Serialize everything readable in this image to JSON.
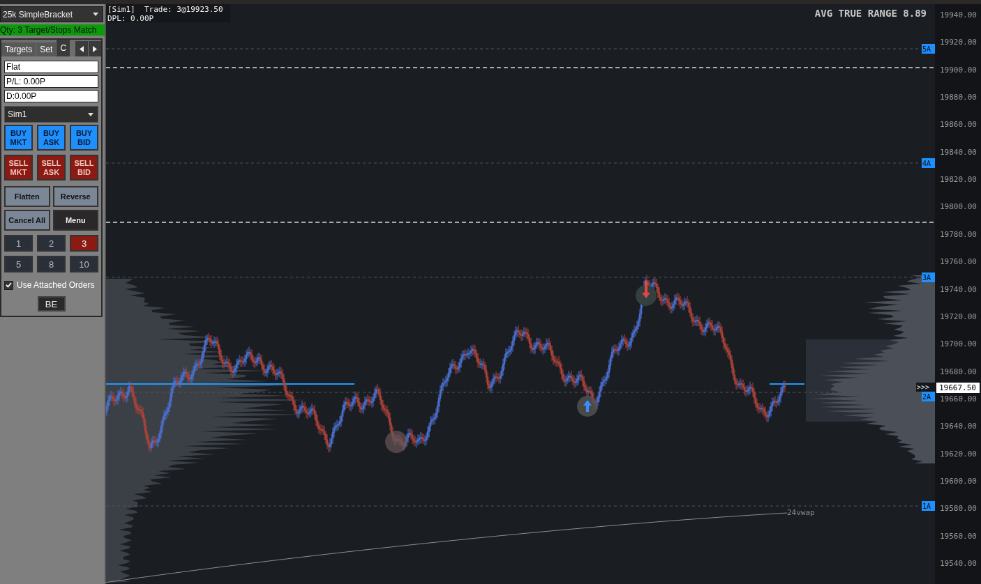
{
  "order_panel": {
    "strategy_dropdown": "25k SimpleBracket",
    "status_banner": "Qty: 3 Target/Stops Match",
    "tabs": [
      {
        "label": "Targets",
        "selected": false
      },
      {
        "label": "Set",
        "selected": false
      },
      {
        "label": "C",
        "selected": true
      }
    ],
    "fields": [
      "Flat",
      "P/L: 0.00P",
      "D:0.00P"
    ],
    "account_dropdown": "Sim1",
    "order_buttons": [
      {
        "kind": "buy",
        "top": "BUY",
        "bottom": "MKT"
      },
      {
        "kind": "buy",
        "top": "BUY",
        "bottom": "ASK"
      },
      {
        "kind": "buy",
        "top": "BUY",
        "bottom": "BID"
      },
      {
        "kind": "sell",
        "top": "SELL",
        "bottom": "MKT"
      },
      {
        "kind": "sell",
        "top": "SELL",
        "bottom": "ASK"
      },
      {
        "kind": "sell",
        "top": "SELL",
        "bottom": "BID"
      }
    ],
    "action_buttons": [
      {
        "kind": "light",
        "label": "Flatten"
      },
      {
        "kind": "light",
        "label": "Reverse"
      },
      {
        "kind": "light",
        "label": "Cancel All"
      },
      {
        "kind": "dark",
        "label": "Menu"
      }
    ],
    "quantity_buttons": [
      {
        "label": "1",
        "selected": false
      },
      {
        "label": "2",
        "selected": false
      },
      {
        "label": "3",
        "selected": true
      },
      {
        "label": "5",
        "selected": false
      },
      {
        "label": "8",
        "selected": false
      },
      {
        "label": "10",
        "selected": false
      }
    ],
    "attached_orders": {
      "label": "Use Attached Orders",
      "checked": true
    },
    "breakeven_button": "BE"
  },
  "chart": {
    "account_info": "[Sim1]  Trade: 3@19923.50",
    "daily_pl": "DPL: 0.00P",
    "indicator_title": "AVG TRUE RANGE 8.89",
    "level_tags": [
      "5A",
      "4A",
      "3A",
      "2A",
      "1A"
    ],
    "vwap_label": "24vwap",
    "last_price_marker": ">>>",
    "last_price": "19667.50",
    "price_axis": [
      "19940.00",
      "19920.00",
      "19900.00",
      "19880.00",
      "19860.00",
      "19840.00",
      "19820.00",
      "19800.00",
      "19780.00",
      "19760.00",
      "19740.00",
      "19720.00",
      "19700.00",
      "19680.00",
      "19660.00",
      "19640.00",
      "19620.00",
      "19600.00",
      "19580.00",
      "19560.00",
      "19540.00"
    ]
  }
}
